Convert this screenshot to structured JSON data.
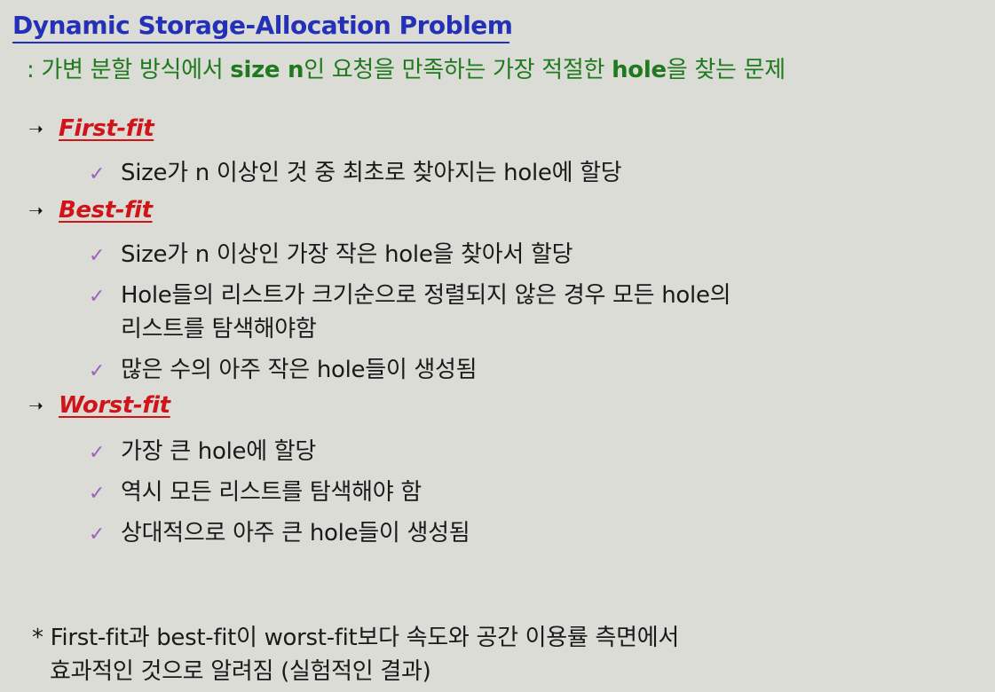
{
  "title": "Dynamic Storage-Allocation Problem",
  "subtitle": {
    "prefix": ": 가변 분할 방식에서 ",
    "bold1": "size n",
    "middle": "인 요청을 만족하는 가장 적절한 ",
    "bold2": "hole",
    "suffix": "을 찾는 문제"
  },
  "sections": [
    {
      "heading": "First-fit",
      "items": [
        "Size가 n 이상인 것 중 최초로 찾아지는 hole에 할당"
      ]
    },
    {
      "heading": "Best-fit",
      "items": [
        "Size가 n 이상인 가장 작은 hole을 찾아서 할당",
        "Hole들의 리스트가 크기순으로 정렬되지 않은 경우 모든 hole의",
        "리스트를 탐색해야함",
        "많은 수의 아주 작은 hole들이 생성됨"
      ]
    },
    {
      "heading": "Worst-fit",
      "items": [
        "가장 큰 hole에 할당",
        "역시 모든 리스트를 탐색해야 함",
        "상대적으로 아주 큰 hole들이 생성됨"
      ]
    }
  ],
  "note": {
    "line1": "* First-fit과 best-fit이 worst-fit보다 속도와 공간 이용률 측면에서",
    "line2": "효과적인 것으로 알려짐 (실험적인 결과)"
  },
  "symbols": {
    "arrow": "➝",
    "check": "✓"
  },
  "colors": {
    "title": "#2430b8",
    "subtitle": "#1f7a1f",
    "heading": "#d0141a",
    "check": "#a060c0",
    "background": "#dcdcd6"
  }
}
